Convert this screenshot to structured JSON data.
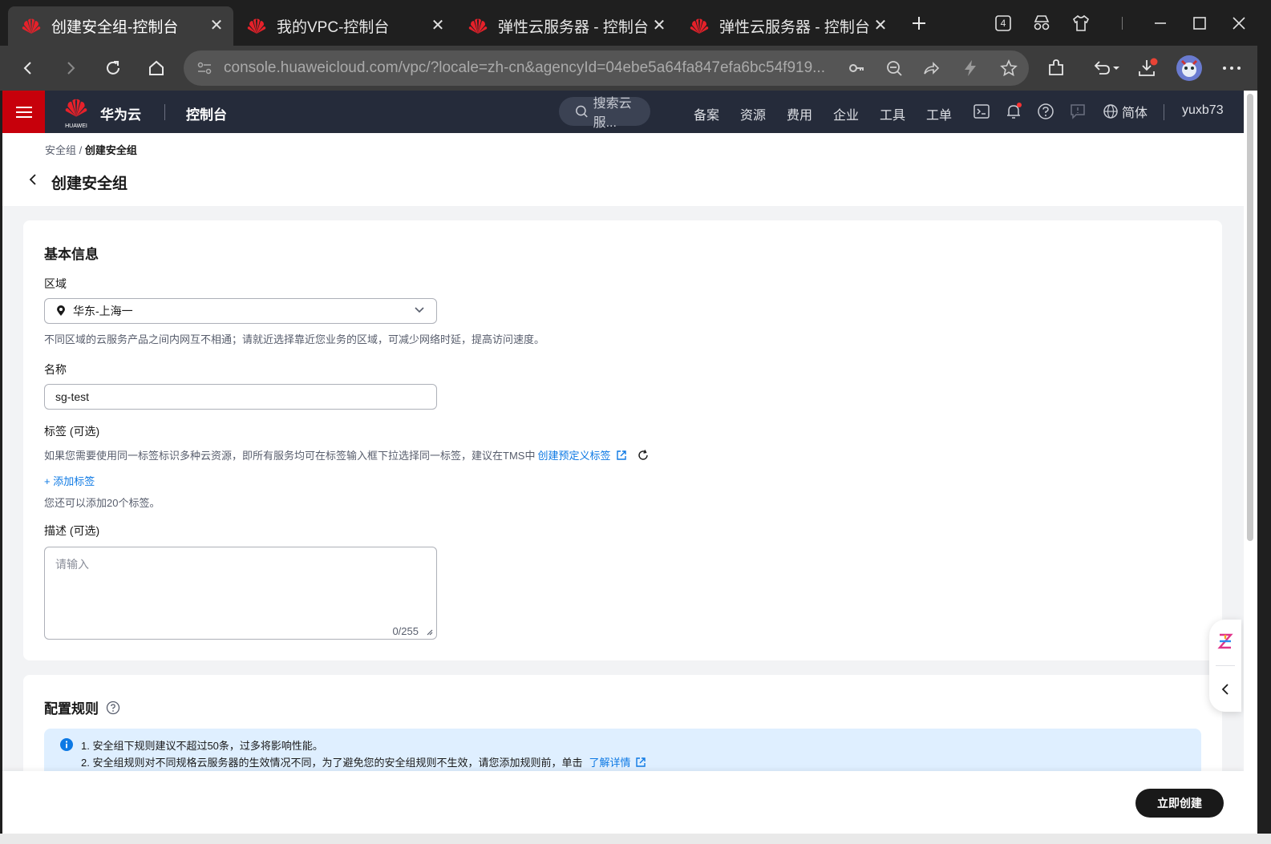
{
  "browser": {
    "tabs": [
      {
        "title": "创建安全组-控制台",
        "active": true
      },
      {
        "title": "我的VPC-控制台",
        "active": false
      },
      {
        "title": "弹性云服务器 - 控制台",
        "active": false
      },
      {
        "title": "弹性云服务器 - 控制台",
        "active": false
      }
    ],
    "tab_count": "4",
    "url": "console.huaweicloud.com/vpc/?locale=zh-cn&agencyId=04ebe5a64fa847efa6bc54f919..."
  },
  "header": {
    "brand": "华为云",
    "logo_text": "HUAWEI",
    "console": "控制台",
    "search_placeholder": "搜索云服...",
    "nav": [
      "备案",
      "资源",
      "费用",
      "企业",
      "工具",
      "工单"
    ],
    "language": "简体",
    "user": "yuxb73",
    "brand_color": "#c7000b"
  },
  "breadcrumb": {
    "parent": "安全组",
    "separator": " / ",
    "current": "创建安全组"
  },
  "page_title": "创建安全组",
  "basic_info": {
    "title": "基本信息",
    "region_label": "区域",
    "region_value": "华东-上海一",
    "region_hint": "不同区域的云服务产品之间内网互不相通；请就近选择靠近您业务的区域，可减少网络时延，提高访问速度。",
    "name_label": "名称",
    "name_value": "sg-test",
    "tag_label": "标签 (可选)",
    "tag_hint": "如果您需要使用同一标签标识多种云资源，即所有服务均可在标签输入框下拉选择同一标签，建议在TMS中",
    "tag_link": "创建预定义标签",
    "add_tag": "+ 添加标签",
    "tag_remaining": "您还可以添加20个标签。",
    "desc_label": "描述 (可选)",
    "desc_placeholder": "请输入",
    "desc_counter": "0/255"
  },
  "rules": {
    "title": "配置规则",
    "info_line1": "1. 安全组下规则建议不超过50条，过多将影响性能。",
    "info_line2": "2. 安全组规则对不同规格云服务器的生效情况不同，为了避免您的安全组规则不生效，请您添加规则前，单击",
    "info_link": "了解详情"
  },
  "footer": {
    "create_button": "立即创建"
  }
}
